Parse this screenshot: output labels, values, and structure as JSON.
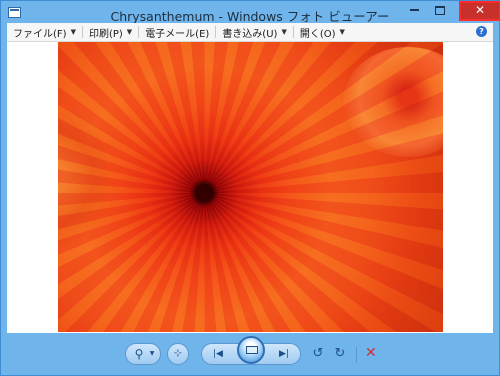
{
  "window": {
    "title": "Chrysanthemum - Windows フォト ビューアー",
    "min_label": "",
    "max_label": "",
    "close_label": "✕"
  },
  "menu": {
    "items": [
      {
        "label": "ファイル(F)",
        "arrow": "▼"
      },
      {
        "label": "印刷(P)",
        "arrow": "▼"
      },
      {
        "label": "電子メール(E)",
        "arrow": ""
      },
      {
        "label": "書き込み(U)",
        "arrow": "▼"
      },
      {
        "label": "開く(O)",
        "arrow": "▼"
      }
    ],
    "help_label": "?"
  },
  "photo": {
    "subject": "chrysanthemum"
  },
  "controls": {
    "zoom_icon": "magnifier-icon",
    "zoom_arrow": "▼",
    "fit_icon": "actual-size-icon",
    "prev_icon": "previous-icon",
    "slideshow_icon": "slideshow-icon",
    "next_icon": "next-icon",
    "rotate_ccw_icon": "rotate-counterclockwise-icon",
    "rotate_cw_icon": "rotate-clockwise-icon",
    "delete_icon": "delete-icon"
  },
  "colors": {
    "accent": "#6fb5eb",
    "close": "#c7302b",
    "delete": "#d52b2b"
  }
}
